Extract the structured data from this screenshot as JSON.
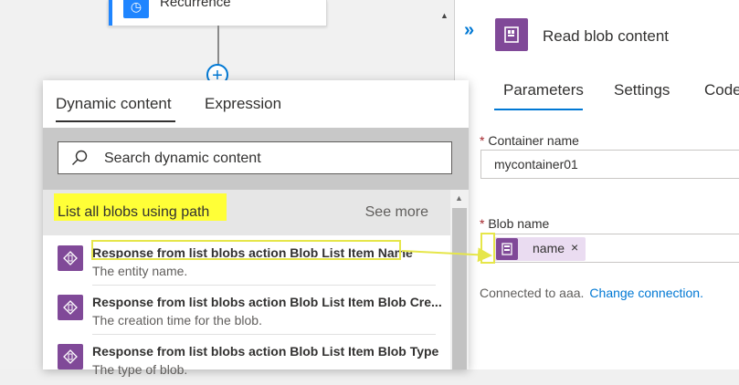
{
  "designer": {
    "card_title": "Recurrence",
    "plus_label": "+"
  },
  "dynamic_panel": {
    "tabs": [
      {
        "label": "Dynamic content"
      },
      {
        "label": "Expression"
      }
    ],
    "search_placeholder": "Search dynamic content",
    "section_title": "List all blobs using path",
    "see_more": "See more",
    "items": [
      {
        "title": "Response from list blobs action Blob List Item Name",
        "desc": "The entity name."
      },
      {
        "title": "Response from list blobs action Blob List Item Blob Cre...",
        "desc": "The creation time for the blob."
      },
      {
        "title": "Response from list blobs action Blob List Item Blob Type",
        "desc": "The type of blob."
      }
    ],
    "highlight_color": "#ffff37",
    "icon_color": "#804998"
  },
  "action_panel": {
    "expand_icon": "»",
    "title": "Read blob content",
    "tabs": [
      {
        "label": "Parameters"
      },
      {
        "label": "Settings"
      },
      {
        "label": "Code"
      }
    ],
    "fields": [
      {
        "required_mark": "*",
        "label": "Container name",
        "value": "mycontainer01"
      },
      {
        "required_mark": "*",
        "label": "Blob name",
        "token": "name",
        "remove": "×"
      }
    ],
    "connection_text": "Connected to aaa.",
    "connection_link": "Change connection.",
    "accent_color": "#0078d4"
  }
}
